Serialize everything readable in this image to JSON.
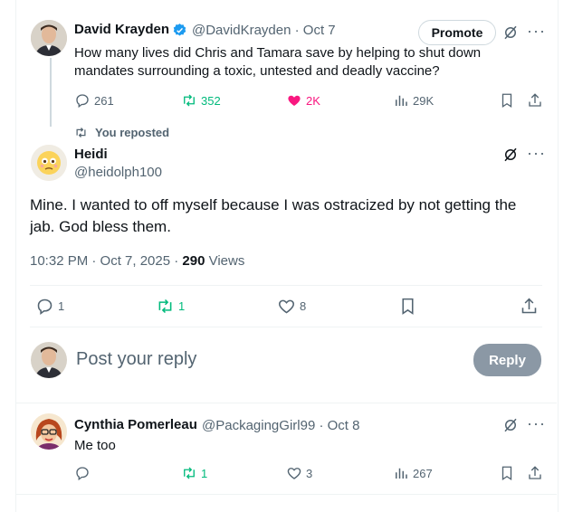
{
  "parent_tweet": {
    "author_name": "David Krayden",
    "handle_date": "@DavidKrayden · Oct 7",
    "promote_label": "Promote",
    "text_line1": "How many lives did Chris and Tamara save by helping to shut down",
    "text_line2": "mandates surrounding a toxic, untested and deadly vaccine?",
    "replies": "261",
    "reposts": "352",
    "likes": "2K",
    "views": "29K"
  },
  "main_tweet": {
    "repost_label": "You reposted",
    "author_name": "Heidi",
    "handle": "@heidolph100",
    "text_line1": "Mine. I wanted to off myself because I was ostracized by not getting the",
    "text_line2": "jab. God bless them.",
    "timestamp": "10:32 PM · Oct 7, 2025 · ",
    "views_count": "290",
    "views_label": " Views",
    "replies": "1",
    "reposts": "1",
    "likes": "8"
  },
  "composer": {
    "placeholder": "Post your reply",
    "reply_label": "Reply"
  },
  "reply_tweet": {
    "author_name": "Cynthia Pomerleau",
    "handle_date": "@PackagingGirl99 · Oct 8",
    "text": "Me too",
    "reposts": "1",
    "likes": "3",
    "views": "267"
  },
  "colors": {
    "accent_blue": "#1d9bf0",
    "repost_green": "#00ba7c",
    "like_pink": "#f91880",
    "muted": "#536471"
  }
}
